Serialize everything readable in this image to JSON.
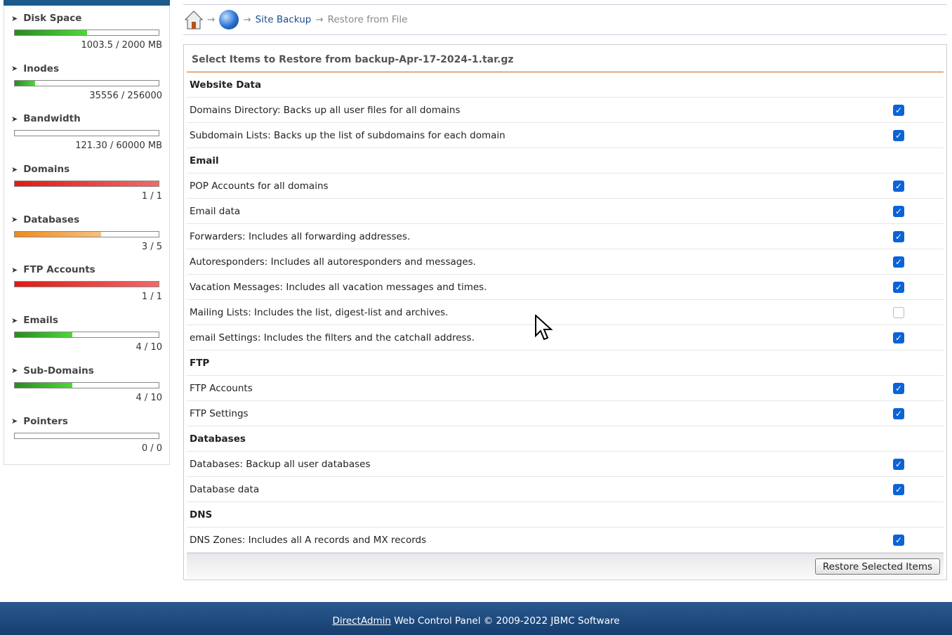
{
  "sidebar": {
    "stats": [
      {
        "label": "Disk Space",
        "value": "1003.5 / 2000 MB",
        "percent": 50,
        "color": "green"
      },
      {
        "label": "Inodes",
        "value": "35556 / 256000",
        "percent": 14,
        "color": "green"
      },
      {
        "label": "Bandwidth",
        "value": "121.30 / 60000 MB",
        "percent": 0,
        "color": "green"
      },
      {
        "label": "Domains",
        "value": "1 / 1",
        "percent": 100,
        "color": "red"
      },
      {
        "label": "Databases",
        "value": "3 / 5",
        "percent": 60,
        "color": "orange"
      },
      {
        "label": "FTP Accounts",
        "value": "1 / 1",
        "percent": 100,
        "color": "red"
      },
      {
        "label": "Emails",
        "value": "4 / 10",
        "percent": 40,
        "color": "green"
      },
      {
        "label": "Sub-Domains",
        "value": "4 / 10",
        "percent": 40,
        "color": "green"
      },
      {
        "label": "Pointers",
        "value": "0 / 0",
        "percent": 0,
        "color": "green"
      }
    ]
  },
  "breadcrumb": {
    "sep": "→",
    "link": "Site Backup",
    "current": "Restore from File"
  },
  "panel": {
    "title": "Select Items to Restore from backup-Apr-17-2024-1.tar.gz",
    "rows": [
      {
        "type": "section",
        "label": "Website Data"
      },
      {
        "label": "Domains Directory: Backs up all user files for all domains",
        "checked": true
      },
      {
        "label": "Subdomain Lists: Backs up the list of subdomains for each domain",
        "checked": true
      },
      {
        "type": "section",
        "label": "Email"
      },
      {
        "label": "POP Accounts for all domains",
        "checked": true
      },
      {
        "label": "Email data",
        "checked": true
      },
      {
        "label": "Forwarders: Includes all forwarding addresses.",
        "checked": true
      },
      {
        "label": "Autoresponders: Includes all autoresponders and messages.",
        "checked": true
      },
      {
        "label": "Vacation Messages: Includes all vacation messages and times.",
        "checked": true
      },
      {
        "label": "Mailing Lists: Includes the list, digest-list and archives.",
        "checked": false
      },
      {
        "label": "email Settings: Includes the filters and the catchall address.",
        "checked": true
      },
      {
        "type": "section",
        "label": "FTP"
      },
      {
        "label": "FTP Accounts",
        "checked": true
      },
      {
        "label": "FTP Settings",
        "checked": true
      },
      {
        "type": "section",
        "label": "Databases"
      },
      {
        "label": "Databases: Backup all user databases",
        "checked": true
      },
      {
        "label": "Database data",
        "checked": true
      },
      {
        "type": "section",
        "label": "DNS"
      },
      {
        "label": "DNS Zones: Includes all A records and MX records",
        "checked": true
      }
    ],
    "button": "Restore Selected Items"
  },
  "footer": {
    "link": "DirectAdmin",
    "text": " Web Control Panel © 2009-2022 JBMC Software"
  },
  "colors": {
    "green": "#3cbf2c",
    "red": "#e8231c",
    "orange": "#f0902a",
    "accent": "#c8641e",
    "header": "#1d5a8c"
  }
}
